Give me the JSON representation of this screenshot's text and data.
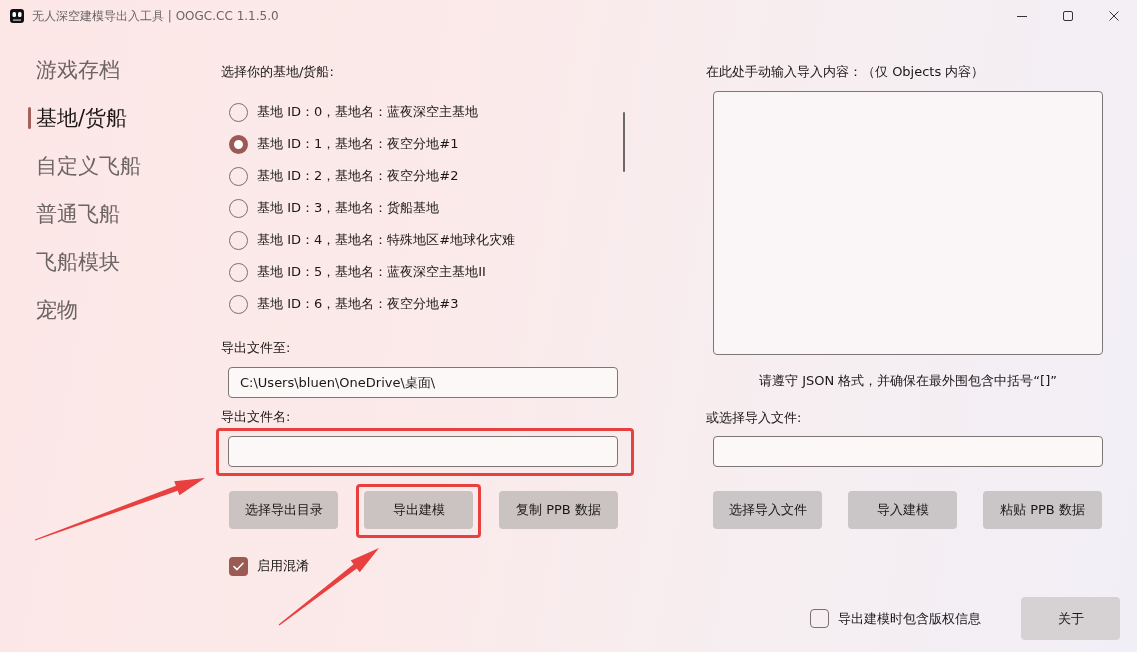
{
  "window": {
    "title": "无人深空建模导出入工具 | OOGC.CC 1.1.5.0"
  },
  "sidebar": {
    "items": [
      {
        "label": "游戏存档",
        "selected": false
      },
      {
        "label": "基地/货船",
        "selected": true
      },
      {
        "label": "自定义飞船",
        "selected": false
      },
      {
        "label": "普通飞船",
        "selected": false
      },
      {
        "label": "飞船模块",
        "selected": false
      },
      {
        "label": "宠物",
        "selected": false
      }
    ]
  },
  "export_panel": {
    "list_label": "选择你的基地/货船:",
    "bases": [
      {
        "label": "基地 ID：0，基地名：蓝夜深空主基地",
        "selected": false
      },
      {
        "label": "基地 ID：1，基地名：夜空分地#1",
        "selected": true
      },
      {
        "label": "基地 ID：2，基地名：夜空分地#2",
        "selected": false
      },
      {
        "label": "基地 ID：3，基地名：货船基地",
        "selected": false
      },
      {
        "label": "基地 ID：4，基地名：特殊地区#地球化灾难",
        "selected": false
      },
      {
        "label": "基地 ID：5，基地名：蓝夜深空主基地II",
        "selected": false
      },
      {
        "label": "基地 ID：6，基地名：夜空分地#3",
        "selected": false
      }
    ],
    "path_label": "导出文件至:",
    "path_field": {
      "value": "C:\\Users\\bluen\\OneDrive\\桌面\\"
    },
    "filename_label": "导出文件名:",
    "filename_field": {
      "highlighted": true
    },
    "buttons": [
      {
        "label": "选择导出目录",
        "highlighted": false
      },
      {
        "label": "导出建模",
        "highlighted": true
      },
      {
        "label": "复制 PPB 数据",
        "highlighted": false
      }
    ],
    "obfuscate": {
      "label": "启用混淆",
      "checked": true
    }
  },
  "import_panel": {
    "input_label": "在此处手动输入导入内容：（仅 Objects 内容）",
    "hint": "请遵守 JSON 格式，并确保在最外围包含中括号“[]”",
    "file_label": "或选择导入文件:",
    "buttons": [
      {
        "label": "选择导入文件"
      },
      {
        "label": "导入建模"
      },
      {
        "label": "粘贴 PPB 数据"
      }
    ]
  },
  "footer": {
    "copyright": {
      "label": "导出建模时包含版权信息",
      "checked": false
    },
    "about_button": "关于"
  }
}
